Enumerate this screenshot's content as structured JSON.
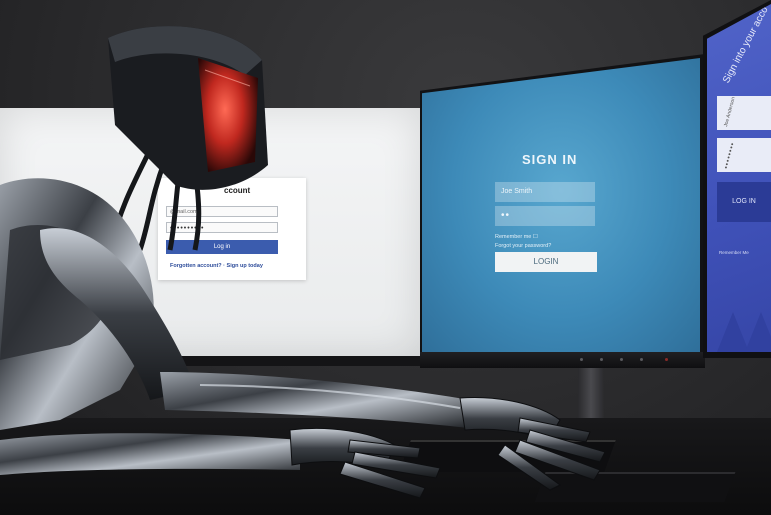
{
  "left_screen": {
    "title": "ccount",
    "email_placeholder": "@mail.com",
    "password_mask": "••••••••••",
    "login_button": "Log in",
    "footer_link": "Forgotten account? · Sign up today"
  },
  "center_screen": {
    "title": "SIGN IN",
    "username_value": "Joe Smith",
    "password_mask": "••",
    "remember_label": "Remember me ☐",
    "forgot_label": "Forgot your password?",
    "login_button": "LOGIN"
  },
  "right_screen": {
    "title": "Sign into your acco",
    "username_value": "Joe Anderson",
    "password_mask": "••••••••",
    "login_button": "LOG IN",
    "remember_label": "Remember Me"
  },
  "colors": {
    "center_screen": "#4a99c4",
    "right_screen": "#4658bd",
    "left_button": "#3b5cae",
    "visor_glow": "#e0302a"
  }
}
